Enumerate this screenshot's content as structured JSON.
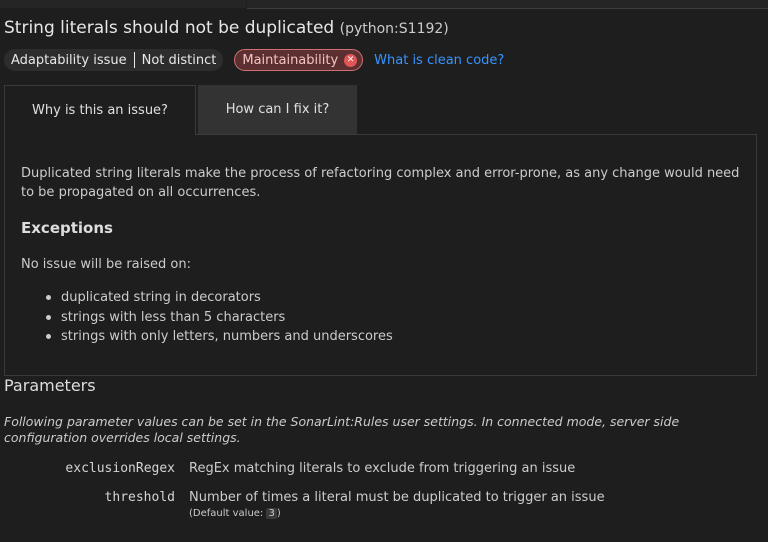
{
  "rule": {
    "title": "String literals should not be duplicated",
    "key": "(python:S1192)"
  },
  "attributes": {
    "category": "Adaptability issue",
    "attribute": "Not distinct",
    "impact": "Maintainability",
    "impact_icon": "error-circle-icon",
    "clean_code_link": "What is clean code?"
  },
  "tabs": [
    {
      "label": "Why is this an issue?",
      "selected": true
    },
    {
      "label": "How can I fix it?",
      "selected": false
    }
  ],
  "description": {
    "text": "Duplicated string literals make the process of refactoring complex and error-prone, as any change would need to be propagated on all occurrences.",
    "exceptions_title": "Exceptions",
    "no_issue_text": "No issue will be raised on:",
    "exceptions": [
      "duplicated string in decorators",
      "strings with less than 5 characters",
      "strings with only letters, numbers and underscores"
    ]
  },
  "parameters": {
    "title": "Parameters",
    "note": "Following parameter values can be set in the SonarLint:Rules user settings. In connected mode, server side configuration overrides local settings.",
    "items": [
      {
        "name": "exclusionRegex",
        "description": "RegEx matching literals to exclude from triggering an issue"
      },
      {
        "name": "threshold",
        "description": "Number of times a literal must be duplicated to trigger an issue",
        "default_prefix": "(Default value: ",
        "default_value": "3",
        "default_suffix": ")"
      }
    ]
  },
  "colors": {
    "background": "#1e1e1e",
    "link": "#3794ff",
    "impact_bg": "#5c3030",
    "impact_border": "#d07070",
    "impact_icon": "#e05555"
  }
}
